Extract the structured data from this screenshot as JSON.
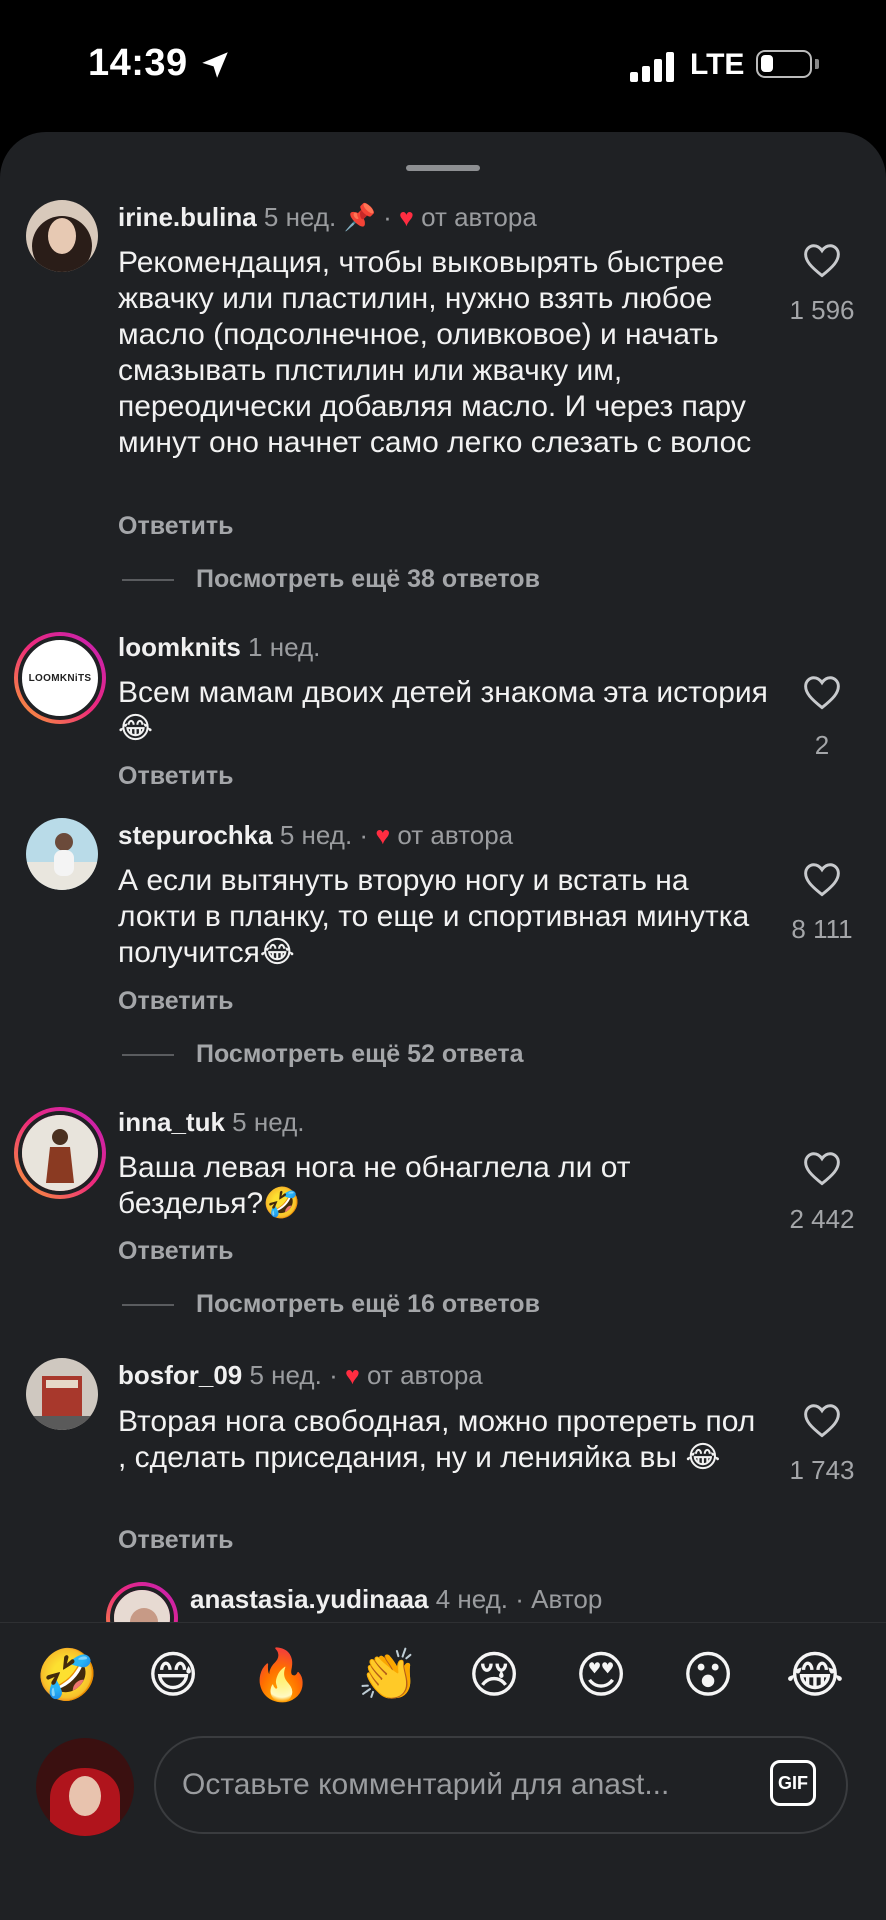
{
  "status": {
    "time": "14:39",
    "network": "LTE"
  },
  "comments": [
    {
      "username": "irine.bulina",
      "time": "5 нед.",
      "author_like": "от автора",
      "text": "Рекомендация, чтобы выковырять быстрее жвачку или пластилин, нужно взять любое масло (подсолнечное, оливковое) и начать смазывать плстилин или жвачку им, переодически добавляя масло. И через пару минут оно начнет само легко слезать с волос",
      "reply": "Ответить",
      "likes": "1 596",
      "more_replies": "Посмотреть ещё 38 ответов"
    },
    {
      "username": "loomknits",
      "time": "1 нед.",
      "avatar_label": "LOOMKNiTS",
      "text": "Всем мамам двоих детей знакома эта история 😂",
      "reply": "Ответить",
      "likes": "2"
    },
    {
      "username": "stepurochka",
      "time": "5 нед.",
      "author_like": "от автора",
      "text": "А если вытянуть вторую ногу и встать на локти в планку, то еще и спортивная минутка получится😂",
      "reply": "Ответить",
      "likes": "8 111",
      "more_replies": "Посмотреть ещё 52 ответа"
    },
    {
      "username": "inna_tuk",
      "time": "5 нед.",
      "text": "Ваша левая нога не обнаглела ли от безделья?🤣",
      "reply": "Ответить",
      "likes": "2 442",
      "more_replies": "Посмотреть ещё 16 ответов"
    },
    {
      "username": "bosfor_09",
      "time": "5 нед.",
      "author_like": "от автора",
      "text": "Вторая нога свободная, можно протереть пол , сделать приседания, ну и ленияйка вы 😂",
      "reply": "Ответить",
      "likes": "1 743"
    },
    {
      "username": "anastasia.yudinaaa",
      "time": "4 нед.",
      "role": "Автор"
    }
  ],
  "emojis": [
    "🤣",
    "😅",
    "🔥",
    "👏",
    "😢",
    "😍",
    "😮",
    "😂"
  ],
  "input": {
    "placeholder": "Оставьте комментарий для anast...",
    "gif_label": "GIF"
  },
  "colors": {
    "sheet_bg": "#1f2124",
    "heart_red": "#ff2d41",
    "muted_text": "#a4a6a9"
  }
}
